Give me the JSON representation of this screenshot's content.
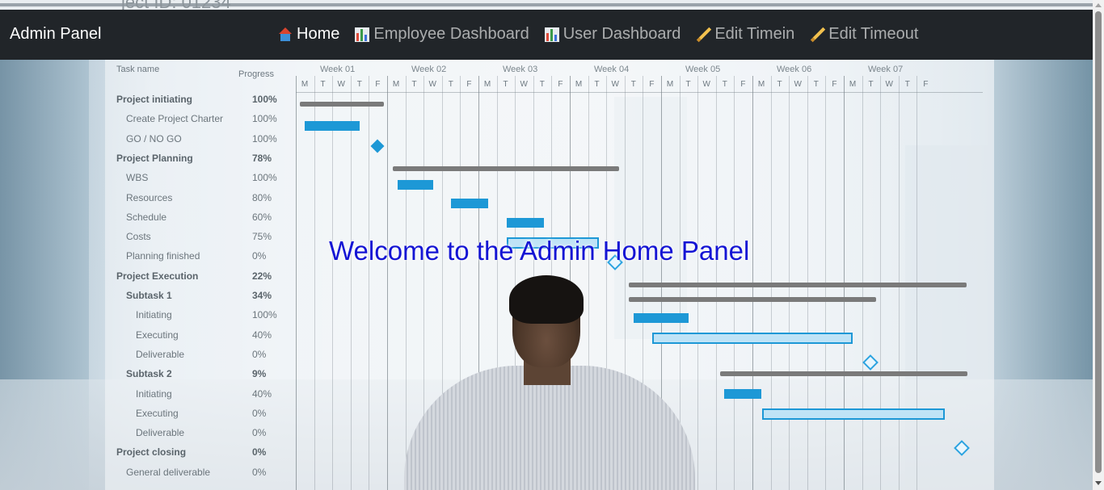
{
  "navbar": {
    "brand": "Admin Panel",
    "items": [
      {
        "label": "Home",
        "icon": "house-icon",
        "active": true
      },
      {
        "label": "Employee Dashboard",
        "icon": "bar-chart-icon",
        "active": false
      },
      {
        "label": "User Dashboard",
        "icon": "bar-chart-icon",
        "active": false
      },
      {
        "label": "Edit Timein",
        "icon": "pencil-icon",
        "active": false
      },
      {
        "label": "Edit Timeout",
        "icon": "pencil-icon",
        "active": false
      }
    ]
  },
  "main": {
    "welcome": "Welcome to the Admin Home Panel"
  },
  "background": {
    "header_ghost": "ject ID: 01234",
    "task_header": "Task name",
    "progress_header": "Progress",
    "weeks": [
      "Week 01",
      "Week 02",
      "Week 03",
      "Week 04",
      "Week 05",
      "Week 06",
      "Week 07"
    ],
    "days": [
      "M",
      "T",
      "W",
      "T",
      "F"
    ],
    "tasks": [
      {
        "name": "Project initiating",
        "progress": "100%",
        "bold": true
      },
      {
        "name": "Create Project Charter",
        "progress": "100%",
        "bold": false
      },
      {
        "name": "GO / NO GO",
        "progress": "100%",
        "bold": false
      },
      {
        "name": "Project Planning",
        "progress": "78%",
        "bold": true
      },
      {
        "name": "WBS",
        "progress": "100%",
        "bold": false
      },
      {
        "name": "Resources",
        "progress": "80%",
        "bold": false
      },
      {
        "name": "Schedule",
        "progress": "60%",
        "bold": false
      },
      {
        "name": "Costs",
        "progress": "75%",
        "bold": false
      },
      {
        "name": "Planning finished",
        "progress": "0%",
        "bold": false
      },
      {
        "name": "Project Execution",
        "progress": "22%",
        "bold": true
      },
      {
        "name": "Subtask 1",
        "progress": "34%",
        "bold": true
      },
      {
        "name": "Initiating",
        "progress": "100%",
        "bold": false
      },
      {
        "name": "Executing",
        "progress": "40%",
        "bold": false
      },
      {
        "name": "Deliverable",
        "progress": "0%",
        "bold": false
      },
      {
        "name": "Subtask 2",
        "progress": "9%",
        "bold": true
      },
      {
        "name": "Initiating",
        "progress": "40%",
        "bold": false
      },
      {
        "name": "Executing",
        "progress": "0%",
        "bold": false
      },
      {
        "name": "Deliverable",
        "progress": "0%",
        "bold": false
      },
      {
        "name": "Project closing",
        "progress": "0%",
        "bold": true
      },
      {
        "name": "General deliverable",
        "progress": "0%",
        "bold": false
      }
    ]
  },
  "colors": {
    "navbar_bg": "#212529",
    "welcome_text": "#1414d4",
    "gantt_blue": "#1d98d6"
  }
}
